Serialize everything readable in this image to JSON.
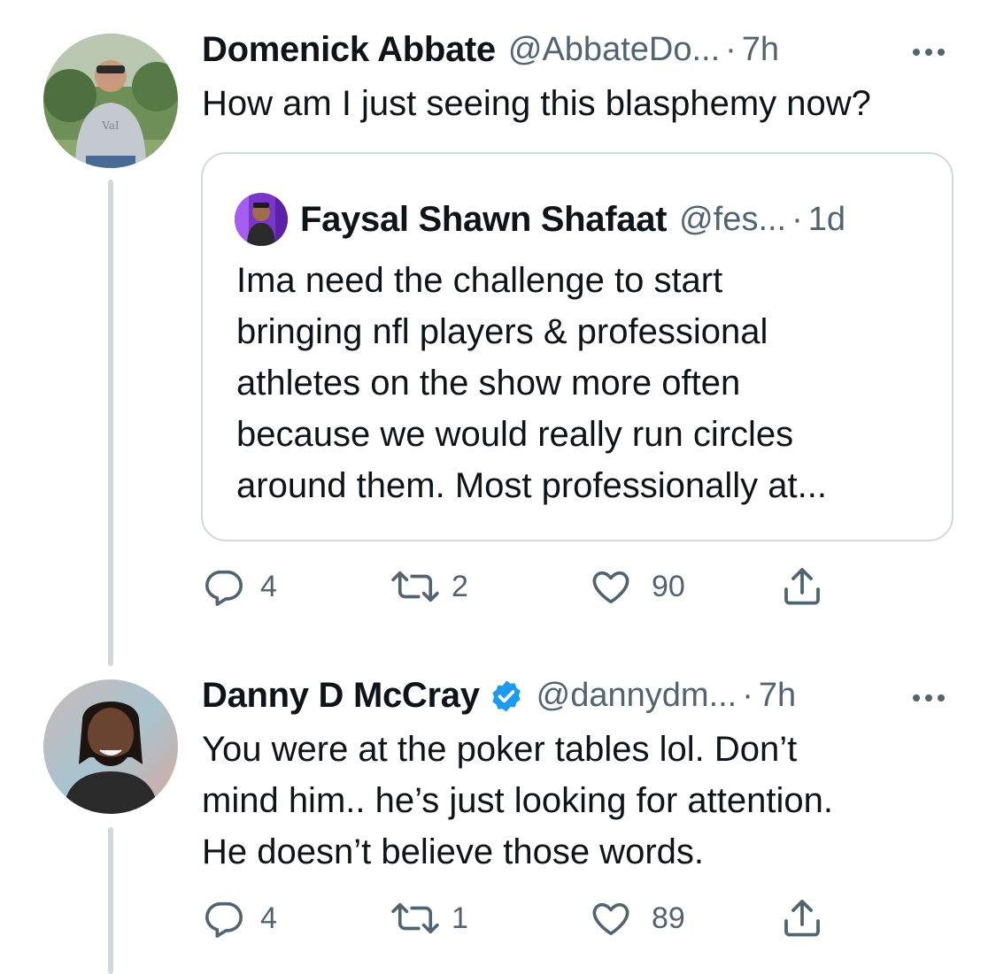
{
  "tweets": [
    {
      "author_name": "Domenick Abbate",
      "handle": "@AbbateDo...",
      "separator": "·",
      "time": "7h",
      "verified": false,
      "avatar_icon": "profile-photo",
      "text": "How am I just seeing this blasphemy now?",
      "quote": {
        "author_name": "Faysal Shawn Shafaat",
        "handle": "@fes...",
        "separator": "·",
        "time": "1d",
        "text_lines": [
          "Ima need the challenge to start",
          "bringing nfl players & professional",
          "athletes on the show more often",
          "because we would really run circles",
          "around them. Most professionally at..."
        ]
      },
      "actions": {
        "replies": "4",
        "retweets": "2",
        "likes": "90"
      }
    },
    {
      "author_name": "Danny D McCray",
      "handle": "@dannydm...",
      "separator": "·",
      "time": "7h",
      "verified": true,
      "avatar_icon": "profile-photo",
      "text_lines": [
        "You were at the poker tables lol. Don’t",
        "mind him.. he’s just looking for attention.",
        "He doesn’t believe those words."
      ],
      "actions": {
        "replies": "4",
        "retweets": "1",
        "likes": "89"
      }
    }
  ],
  "colors": {
    "text_primary": "#0f1419",
    "text_secondary": "#536471",
    "border": "#cfd9de",
    "verified_blue": "#1d9bf0"
  },
  "icons": [
    "reply-icon",
    "retweet-icon",
    "like-icon",
    "share-icon",
    "more-icon",
    "verified-badge-icon"
  ]
}
